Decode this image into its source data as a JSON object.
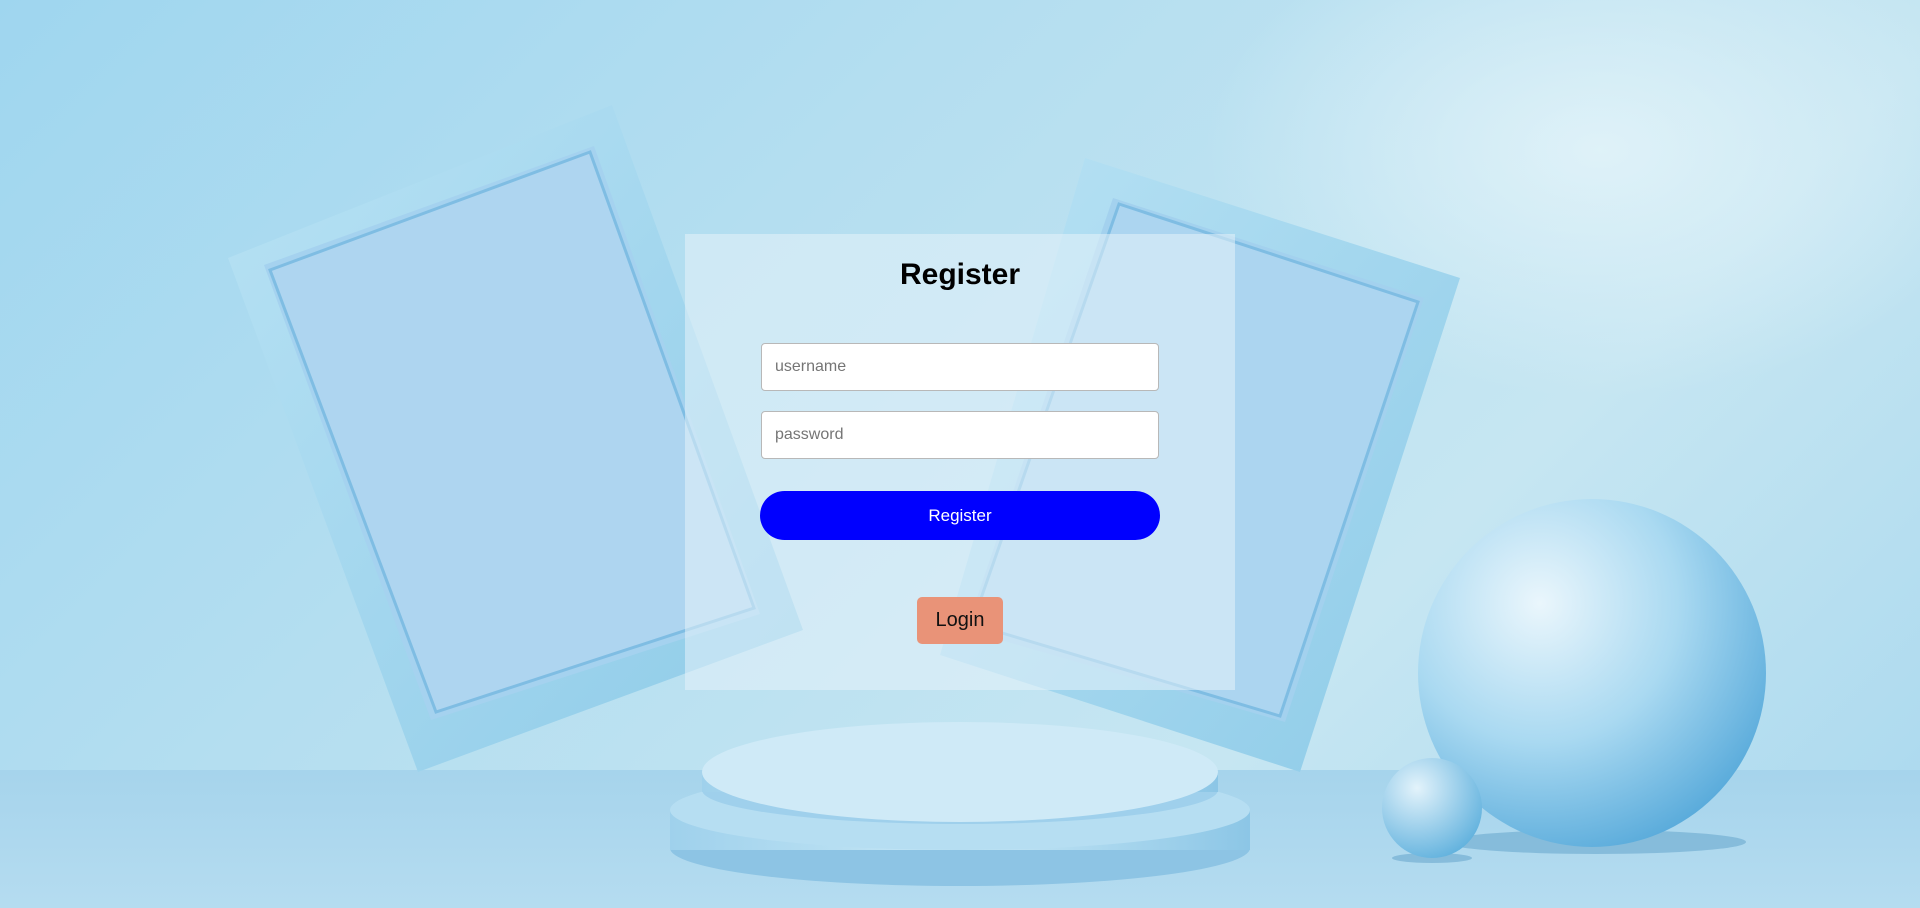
{
  "form": {
    "title": "Register",
    "username_placeholder": "username",
    "password_placeholder": "password",
    "register_label": "Register",
    "login_label": "Login"
  },
  "colors": {
    "register_button": "#0000ff",
    "login_button": "#e99378",
    "background": "#b4def0"
  }
}
